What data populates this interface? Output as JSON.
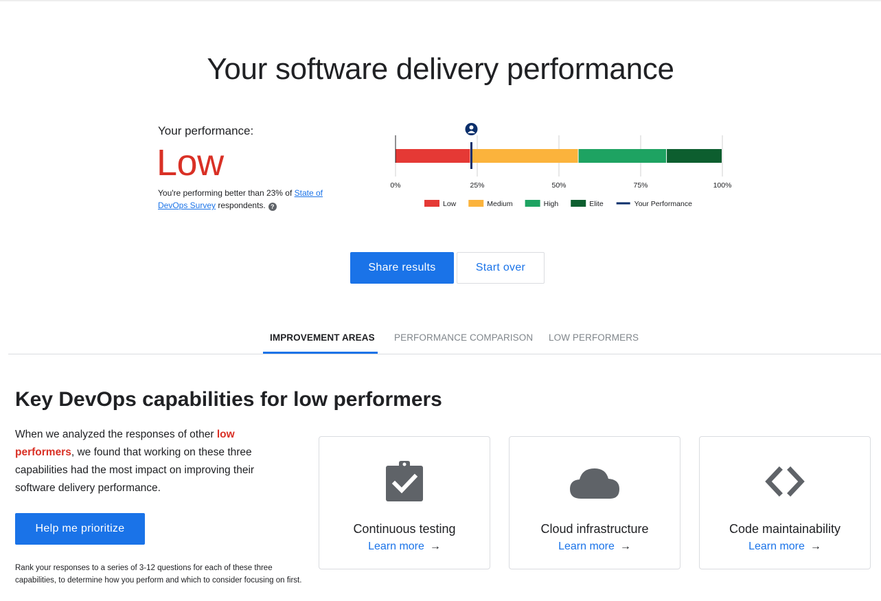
{
  "page": {
    "title": "Your software delivery performance"
  },
  "performance": {
    "label": "Your performance:",
    "level": "Low",
    "note_prefix": "You're performing better than 23% of ",
    "note_link": "State of DevOps Survey",
    "note_suffix": " respondents.",
    "help_icon": "?"
  },
  "chart_data": {
    "type": "bar",
    "orientation": "horizontal-stacked",
    "segments": [
      {
        "name": "Low",
        "start": 0,
        "end": 23,
        "color": "#e53935"
      },
      {
        "name": "Medium",
        "start": 23,
        "end": 56,
        "color": "#fbb33c"
      },
      {
        "name": "High",
        "start": 56,
        "end": 83,
        "color": "#1ea362"
      },
      {
        "name": "Elite",
        "start": 83,
        "end": 100,
        "color": "#0d5e2f"
      }
    ],
    "marker": {
      "name": "Your Performance",
      "value": 23,
      "color": "#0b2f6b"
    },
    "ticks": [
      0,
      25,
      50,
      75,
      100
    ],
    "tick_labels": [
      "0%",
      "25%",
      "50%",
      "75%",
      "100%"
    ],
    "xlim": [
      0,
      100
    ],
    "grid": true,
    "legend": [
      {
        "label": "Low",
        "color": "#e53935",
        "kind": "box"
      },
      {
        "label": "Medium",
        "color": "#fbb33c",
        "kind": "box"
      },
      {
        "label": "High",
        "color": "#1ea362",
        "kind": "box"
      },
      {
        "label": "Elite",
        "color": "#0d5e2f",
        "kind": "box"
      },
      {
        "label": "Your Performance",
        "color": "#0b2f6b",
        "kind": "line"
      }
    ],
    "legend_position": "bottom"
  },
  "actions": {
    "share": "Share results",
    "start_over": "Start over"
  },
  "tabs": [
    {
      "label": "IMPROVEMENT AREAS",
      "active": true
    },
    {
      "label": "PERFORMANCE COMPARISON",
      "active": false
    },
    {
      "label": "LOW PERFORMERS",
      "active": false
    }
  ],
  "section": {
    "title": "Key DevOps capabilities for low performers",
    "desc_prefix": "When we analyzed the responses of other ",
    "desc_highlight": "low performers",
    "desc_suffix": ", we found that working on these three capabilities had the most impact on improving their software delivery performance.",
    "prioritize_button": "Help me prioritize",
    "rank_note": "Rank your responses to a series of 3-12 questions for each of these three capabilities, to determine how you perform and which to consider focusing on first."
  },
  "capabilities": [
    {
      "title": "Continuous testing",
      "learn_more": "Learn more",
      "icon": "clipboard-check-icon"
    },
    {
      "title": "Cloud infrastructure",
      "learn_more": "Learn more",
      "icon": "cloud-icon"
    },
    {
      "title": "Code maintainability",
      "learn_more": "Learn more",
      "icon": "code-icon"
    }
  ],
  "colors": {
    "accent": "#1a73e8",
    "low_red": "#d93025",
    "icon_gray": "#5f6368"
  }
}
